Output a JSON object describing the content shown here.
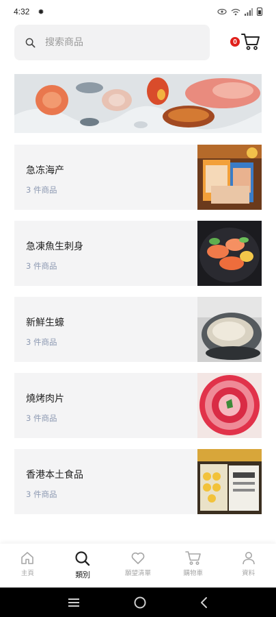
{
  "status": {
    "time": "4:32"
  },
  "search": {
    "placeholder": "搜索商品"
  },
  "cart": {
    "badge_count": "0"
  },
  "categories": [
    {
      "name": "急冻海产",
      "count": "3 件商品"
    },
    {
      "name": "急凍魚生刺身",
      "count": "3 件商品"
    },
    {
      "name": "新鮮生蠔",
      "count": "3 件商品"
    },
    {
      "name": "燒烤肉片",
      "count": "3 件商品"
    },
    {
      "name": "香港本土食品",
      "count": "3 件商品"
    }
  ],
  "tabs": [
    {
      "label": "主頁",
      "icon": "home-icon",
      "active": false
    },
    {
      "label": "類別",
      "icon": "search-icon",
      "active": true
    },
    {
      "label": "願望清單",
      "icon": "heart-icon",
      "active": false
    },
    {
      "label": "購物車",
      "icon": "cart-icon",
      "active": false
    },
    {
      "label": "資料",
      "icon": "user-icon",
      "active": false
    }
  ],
  "colors": {
    "accent": "#e0201b",
    "card_bg": "#f4f4f5",
    "count_text": "#8e9ab3"
  }
}
